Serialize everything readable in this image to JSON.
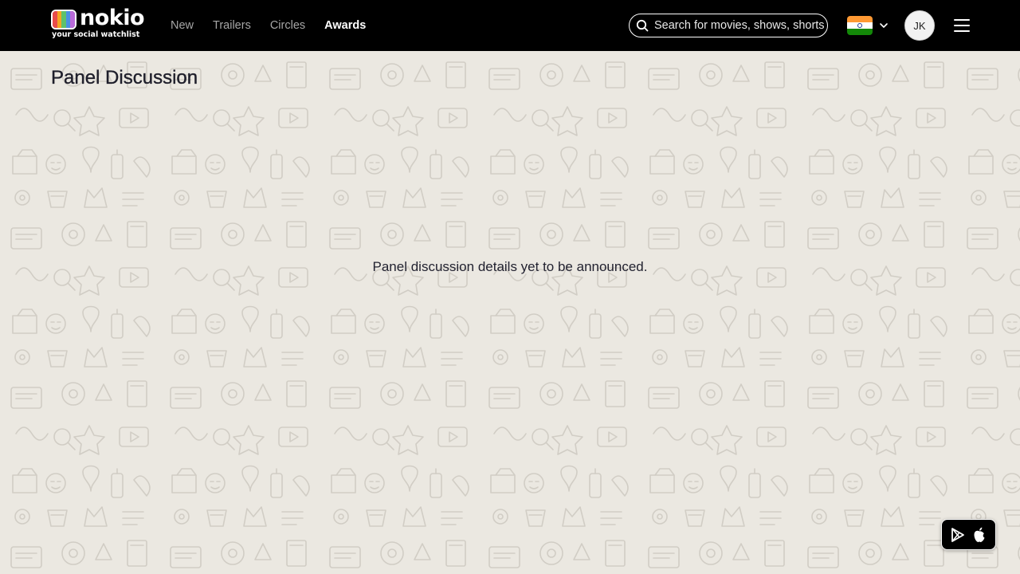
{
  "brand": {
    "name": "nokio",
    "tagline": "your social watchlist",
    "tv_colors": [
      "#e94b4b",
      "#f5a623",
      "#5ec26a",
      "#4a90e2",
      "#b96ad9"
    ]
  },
  "nav": {
    "items": [
      {
        "label": "New",
        "active": false
      },
      {
        "label": "Trailers",
        "active": false
      },
      {
        "label": "Circles",
        "active": false
      },
      {
        "label": "Awards",
        "active": true
      }
    ]
  },
  "search": {
    "placeholder": "Search for movies, shows, shorts",
    "value": ""
  },
  "country": {
    "flag": "india-flag",
    "colors": {
      "saffron": "#ff9933",
      "white": "#ffffff",
      "green": "#138808",
      "chakra": "#1f3a93"
    }
  },
  "user": {
    "initials": "JK"
  },
  "page": {
    "title": "Panel Discussion",
    "empty_message": "Panel discussion details yet to be announced."
  },
  "app_badge": {
    "icons": [
      "google-play-icon",
      "apple-icon"
    ]
  },
  "colors": {
    "topbar": "#000000",
    "background": "#ebe8e1",
    "pattern": "#c9c5bc",
    "text": "#1f1f2b"
  }
}
